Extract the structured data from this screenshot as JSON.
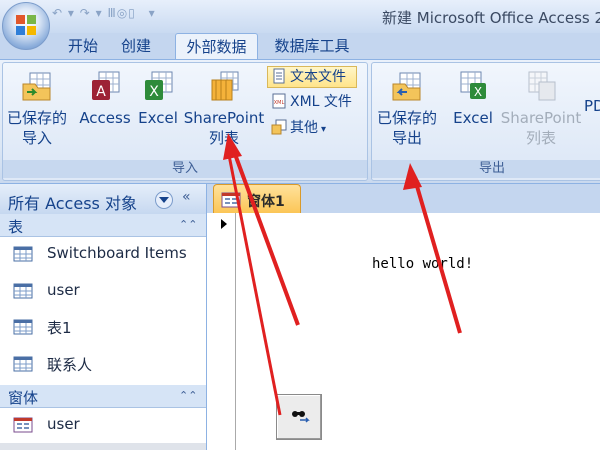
{
  "window": {
    "title": "新建 Microsoft Office Access 2"
  },
  "qat": {
    "items": [
      "undo-icon",
      "redo-icon",
      "customize-icon"
    ]
  },
  "tabs": [
    {
      "label": "开始"
    },
    {
      "label": "创建"
    },
    {
      "label": "外部数据",
      "active": true
    },
    {
      "label": "数据库工具"
    }
  ],
  "ribbon": {
    "import_group": {
      "label": "导入",
      "saved_import": {
        "line1": "已保存的",
        "line2": "导入"
      },
      "access": "Access",
      "excel": "Excel",
      "sharepoint": {
        "line1": "SharePoint",
        "line2": "列表"
      },
      "text_file": "文本文件",
      "xml_file": "XML 文件",
      "more": "其他"
    },
    "export_group": {
      "label": "导出",
      "saved_export": {
        "line1": "已保存的",
        "line2": "导出"
      },
      "excel": "Excel",
      "sharepoint": {
        "line1": "SharePoint",
        "line2": "列表"
      },
      "pdf": "PD"
    }
  },
  "nav": {
    "title": "所有 Access 对象",
    "sections": [
      {
        "title": "表",
        "items": [
          "Switchboard Items",
          "user",
          "表1",
          "联系人"
        ]
      },
      {
        "title": "窗体",
        "items": [
          "user"
        ]
      }
    ]
  },
  "document": {
    "tab_label": "窗体1",
    "label_text": "hello world!"
  },
  "colors": {
    "accent": "#15428b",
    "arrow": "#e02020",
    "active_doc_tab": "#fbc554"
  }
}
